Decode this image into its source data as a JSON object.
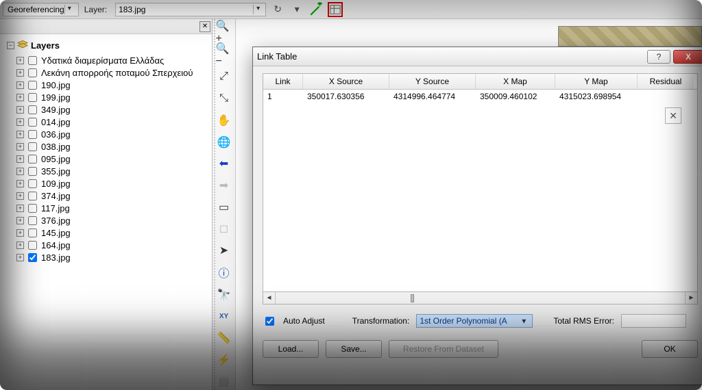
{
  "toolbar": {
    "georef_label": "Georeferencing",
    "layer_label": "Layer:",
    "layer_value": "183.jpg"
  },
  "toc": {
    "title": "Layers",
    "items": [
      {
        "name": "Υδατικά διαμερίσματα Ελλάδας",
        "checked": false
      },
      {
        "name": "Λεκάνη απορροής ποταμού Σπερχειού",
        "checked": false
      },
      {
        "name": "190.jpg",
        "checked": false
      },
      {
        "name": "199.jpg",
        "checked": false
      },
      {
        "name": "349.jpg",
        "checked": false
      },
      {
        "name": "014.jpg",
        "checked": false
      },
      {
        "name": "036.jpg",
        "checked": false
      },
      {
        "name": "038.jpg",
        "checked": false
      },
      {
        "name": "095.jpg",
        "checked": false
      },
      {
        "name": "355.jpg",
        "checked": false
      },
      {
        "name": "109.jpg",
        "checked": false
      },
      {
        "name": "374.jpg",
        "checked": false
      },
      {
        "name": "117.jpg",
        "checked": false
      },
      {
        "name": "376.jpg",
        "checked": false
      },
      {
        "name": "145.jpg",
        "checked": false
      },
      {
        "name": "164.jpg",
        "checked": false
      },
      {
        "name": "183.jpg",
        "checked": true
      }
    ]
  },
  "vtools": [
    "zoom-in-icon",
    "zoom-out-icon",
    "fixed-zoom-in-icon",
    "fixed-zoom-out-icon",
    "pan-icon",
    "full-extent-icon",
    "back-extent-icon",
    "forward-extent-icon",
    "select-element-icon",
    "deselect-icon",
    "pointer-icon",
    "identify-icon",
    "find-icon",
    "xy-icon",
    "measure-icon",
    "flash-icon",
    "html-icon"
  ],
  "linktable": {
    "title": "Link Table",
    "columns": [
      "Link",
      "X Source",
      "Y Source",
      "X Map",
      "Y Map",
      "Residual"
    ],
    "rows": [
      {
        "link": "1",
        "xsrc": "350017.630356",
        "ysrc": "4314996.464774",
        "xmap": "350009.460102",
        "ymap": "4315023.698954",
        "res": ""
      }
    ],
    "auto_adjust_label": "Auto Adjust",
    "auto_adjust_checked": true,
    "transformation_label": "Transformation:",
    "transformation_value": "1st Order Polynomial (A",
    "rms_label": "Total RMS Error:",
    "rms_value": "",
    "load_btn": "Load...",
    "save_btn": "Save...",
    "restore_btn": "Restore From Dataset",
    "ok_btn": "OK",
    "help_btn": "?",
    "close_btn": "X"
  }
}
